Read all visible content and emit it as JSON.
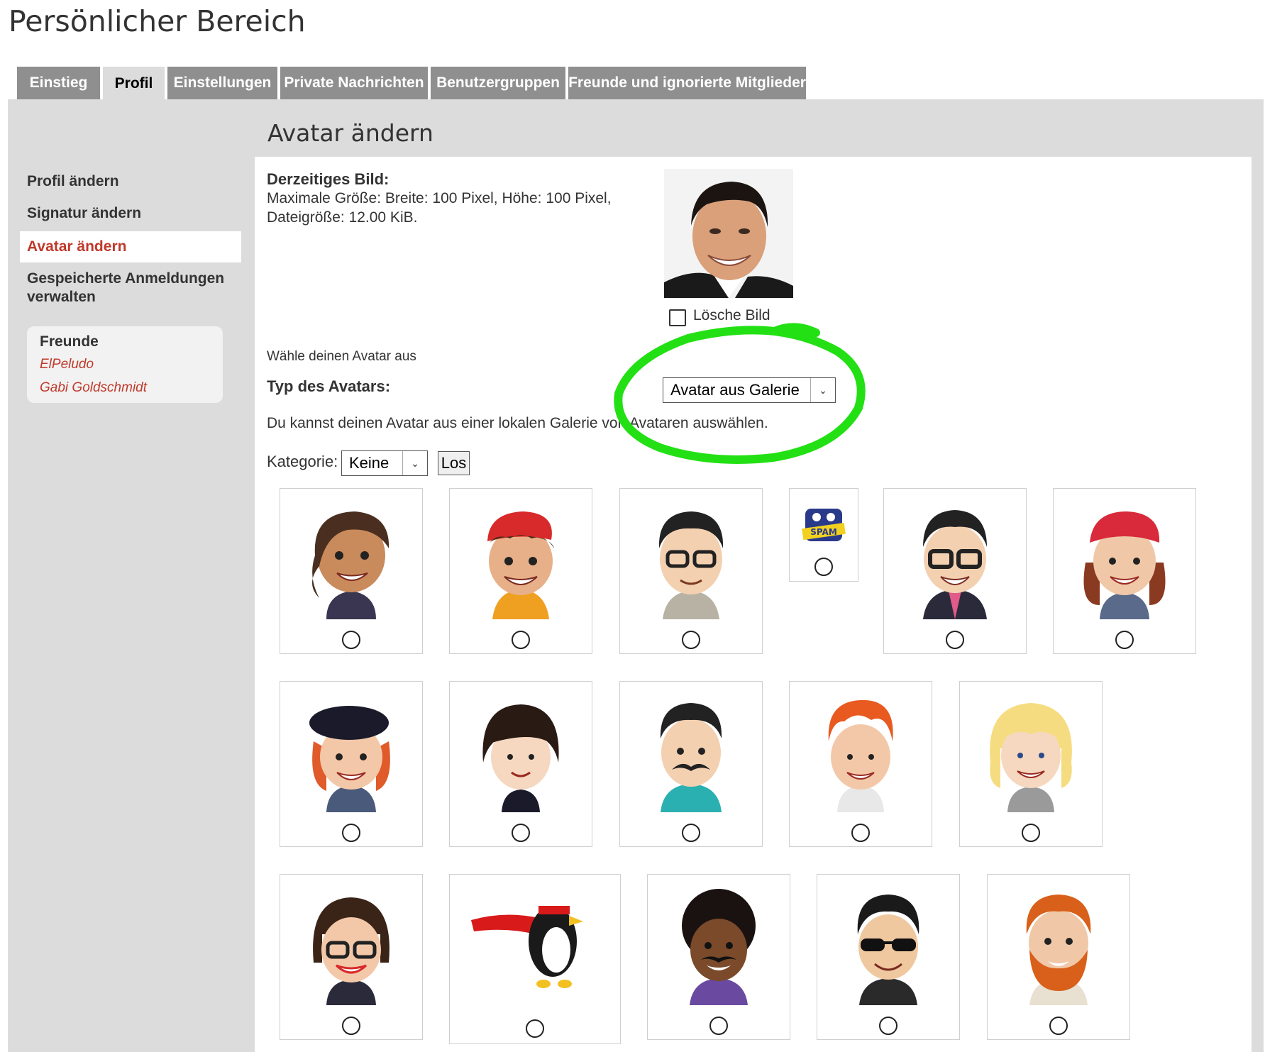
{
  "page": {
    "title": "Persönlicher Bereich"
  },
  "tabs": [
    {
      "label": "Einstieg",
      "active": false
    },
    {
      "label": "Profil",
      "active": true
    },
    {
      "label": "Einstellungen",
      "active": false
    },
    {
      "label": "Private Nachrichten",
      "active": false
    },
    {
      "label": "Benutzergruppen",
      "active": false
    },
    {
      "label": "Freunde und ignorierte Mitglieder",
      "active": false
    }
  ],
  "sidebar": {
    "items": [
      {
        "label": "Profil ändern",
        "active": false
      },
      {
        "label": "Signatur ändern",
        "active": false
      },
      {
        "label": "Avatar ändern",
        "active": true
      },
      {
        "label": "Gespeicherte Anmeldungen verwalten",
        "active": false
      }
    ],
    "friends": {
      "title": "Freunde",
      "list": [
        "ElPeludo",
        "Gabi Goldschmidt"
      ]
    }
  },
  "main": {
    "section_title": "Avatar ändern",
    "current": {
      "label": "Derzeitiges Bild:",
      "info_line1": "Maximale Größe: Breite: 100 Pixel, Höhe: 100 Pixel,",
      "info_line2": "Dateigröße: 12.00 KiB.",
      "delete_label": "Lösche Bild"
    },
    "choose_label": "Wähle deinen Avatar aus",
    "type_label": "Typ des Avatars:",
    "type_value": "Avatar aus Galerie",
    "gallery_hint": "Du kannst deinen Avatar aus einer lokalen Galerie von Avataren auswählen.",
    "category_label": "Kategorie:",
    "category_value": "Keine",
    "go_button": "Los"
  },
  "colors": {
    "link_red": "#c0392b",
    "tab_gray": "#8f8f8f",
    "panel_gray": "#dcdcdc",
    "annotation_green": "#22e014"
  },
  "gallery": {
    "rows": [
      [
        "girl-brown-hair",
        "boy-red-beret",
        "man-glasses",
        "spam-mascot",
        "man-glasses-suit",
        "woman-red-bandana"
      ],
      [
        "girl-black-beret",
        "woman-bob-hair",
        "man-mustache",
        "redhead-boy",
        "blonde-woman"
      ],
      [
        "woman-glasses",
        "penguin-superhero",
        "man-afro",
        "man-sunglasses",
        "man-red-beard"
      ]
    ]
  }
}
